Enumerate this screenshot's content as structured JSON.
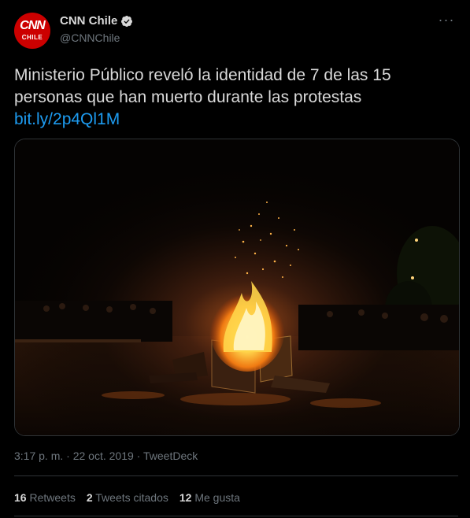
{
  "account": {
    "avatar_text_top": "CNN",
    "avatar_text_bottom": "CHILE",
    "display_name": "CNN Chile",
    "handle": "@CNNChile"
  },
  "tweet": {
    "text": "Ministerio Público reveló la identidad de 7 de las 15 personas que han muerto durante las protestas",
    "link": "bit.ly/2p4Ql1M",
    "time": "3:17 p. m.",
    "separator": "·",
    "date": "22 oct. 2019",
    "source": "TweetDeck"
  },
  "stats": {
    "retweets_count": "16",
    "retweets_label": "Retweets",
    "quotes_count": "2",
    "quotes_label": "Tweets citados",
    "likes_count": "12",
    "likes_label": "Me gusta"
  },
  "colors": {
    "background": "#000000",
    "text": "#d9d9d9",
    "muted": "#6e767d",
    "link": "#1d9bf0",
    "brand": "#cc0000",
    "divider": "#2f3336"
  },
  "icons": {
    "verified": "verified-badge-icon",
    "more": "more-options-icon"
  }
}
